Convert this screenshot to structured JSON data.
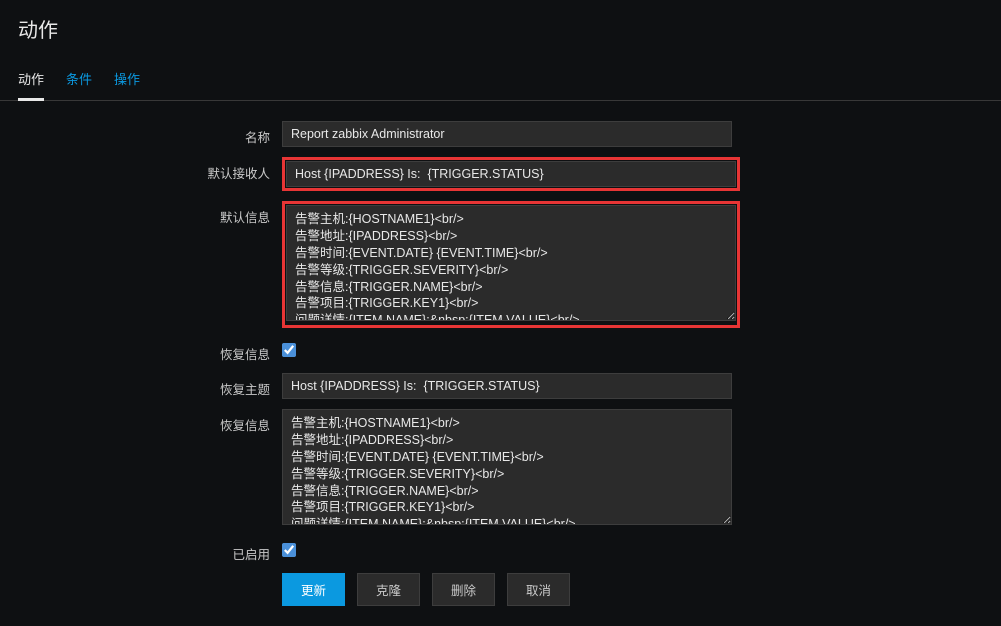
{
  "page_title": "动作",
  "tabs": {
    "action": "动作",
    "condition": "条件",
    "operation": "操作"
  },
  "form": {
    "name_label": "名称",
    "name_value": "Report zabbix Administrator",
    "default_recipient_label": "默认接收人",
    "default_recipient_value": "Host {IPADDRESS} Is:  {TRIGGER.STATUS}",
    "default_message_label": "默认信息",
    "default_message_value": "告警主机:{HOSTNAME1}<br/>\n告警地址:{IPADDRESS}<br/>\n告警时间:{EVENT.DATE} {EVENT.TIME}<br/>\n告警等级:{TRIGGER.SEVERITY}<br/>\n告警信息:{TRIGGER.NAME}<br/>\n告警项目:{TRIGGER.KEY1}<br/>\n问题详情:{ITEM.NAME}:&nbsp;{ITEM.VALUE}<br/>",
    "recovery_message_label": "恢复信息",
    "recovery_message_checked": true,
    "recovery_subject_label": "恢复主题",
    "recovery_subject_value": "Host {IPADDRESS} Is:  {TRIGGER.STATUS}",
    "recovery_info_label": "恢复信息",
    "recovery_info_value": "告警主机:{HOSTNAME1}<br/>\n告警地址:{IPADDRESS}<br/>\n告警时间:{EVENT.DATE} {EVENT.TIME}<br/>\n告警等级:{TRIGGER.SEVERITY}<br/>\n告警信息:{TRIGGER.NAME}<br/>\n告警项目:{TRIGGER.KEY1}<br/>\n问题详情:{ITEM.NAME}:&nbsp;{ITEM.VALUE}<br/>",
    "enabled_label": "已启用",
    "enabled_checked": true
  },
  "buttons": {
    "update": "更新",
    "clone": "克隆",
    "delete": "删除",
    "cancel": "取消"
  }
}
